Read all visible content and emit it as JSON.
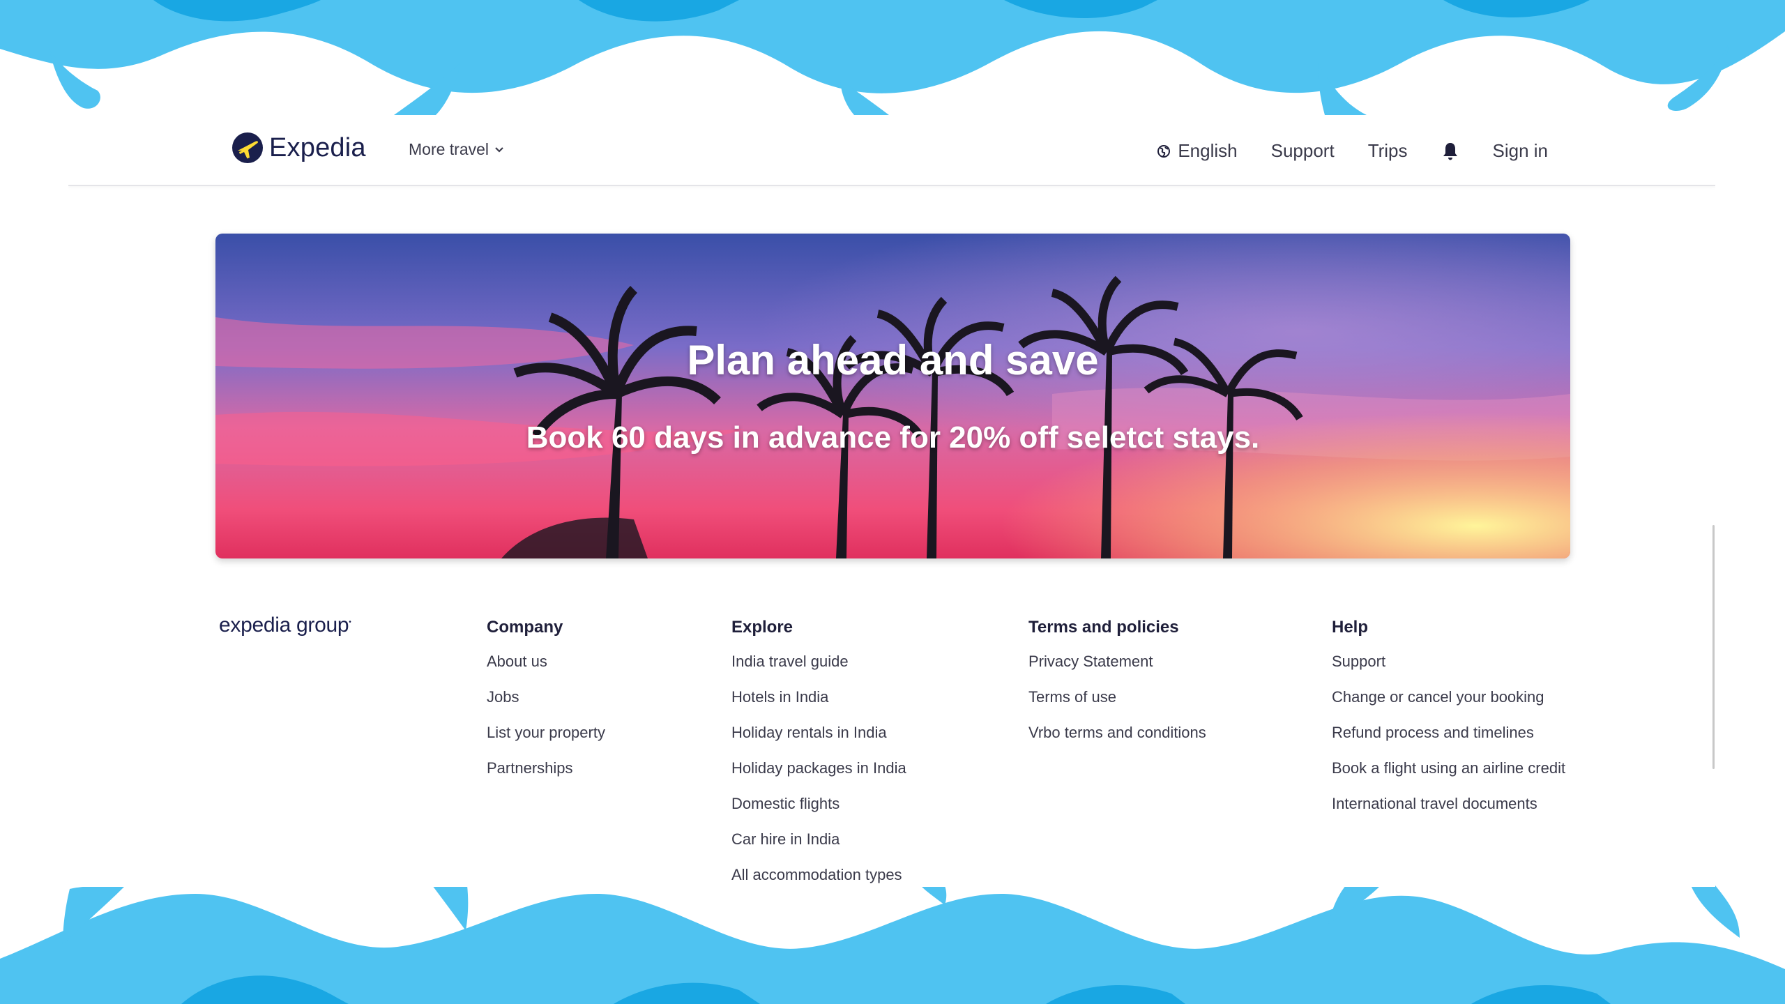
{
  "header": {
    "brand": "Expedia",
    "more_travel": "More travel",
    "nav": {
      "language": "English",
      "support": "Support",
      "trips": "Trips",
      "sign_in": "Sign in"
    }
  },
  "hero": {
    "title": "Plan ahead and save",
    "subtitle": "Book 60 days in advance for 20% off seletct stays."
  },
  "footer": {
    "brand": "expedia group",
    "columns": [
      {
        "heading": "Company",
        "links": [
          "About us",
          "Jobs",
          "List your property",
          "Partnerships"
        ]
      },
      {
        "heading": "Explore",
        "links": [
          "India travel guide",
          "Hotels in India",
          "Holiday rentals in India",
          "Holiday packages in India",
          "Domestic flights",
          "Car hire in India",
          "All accommodation types"
        ]
      },
      {
        "heading": "Terms and policies",
        "links": [
          "Privacy Statement",
          "Terms of use",
          "Vrbo terms and conditions"
        ]
      },
      {
        "heading": "Help",
        "links": [
          "Support",
          "Change or cancel your booking",
          "Refund process and timelines",
          "Book a flight using an airline credit",
          "International travel documents"
        ]
      }
    ]
  },
  "colors": {
    "wave_light": "#4fc3f1",
    "wave_dark": "#19a7e3",
    "brand_navy": "#1a1f4c",
    "brand_yellow": "#fddb32"
  }
}
